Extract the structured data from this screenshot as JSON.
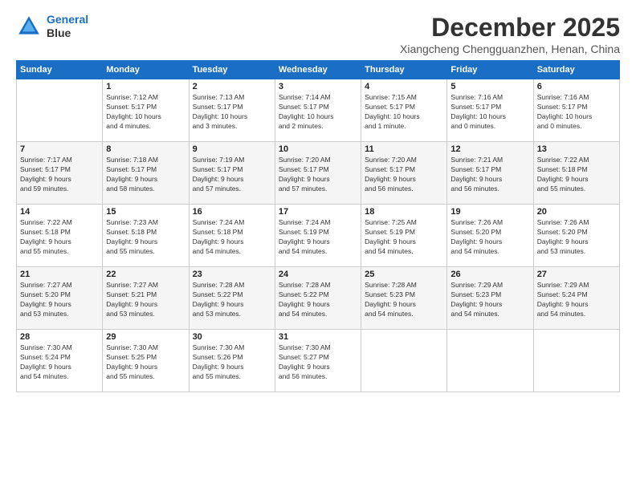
{
  "header": {
    "logo_line1": "General",
    "logo_line2": "Blue",
    "month_title": "December 2025",
    "location": "Xiangcheng Chengguanzhen, Henan, China"
  },
  "days_of_week": [
    "Sunday",
    "Monday",
    "Tuesday",
    "Wednesday",
    "Thursday",
    "Friday",
    "Saturday"
  ],
  "weeks": [
    [
      {
        "day": "",
        "info": ""
      },
      {
        "day": "1",
        "info": "Sunrise: 7:12 AM\nSunset: 5:17 PM\nDaylight: 10 hours\nand 4 minutes."
      },
      {
        "day": "2",
        "info": "Sunrise: 7:13 AM\nSunset: 5:17 PM\nDaylight: 10 hours\nand 3 minutes."
      },
      {
        "day": "3",
        "info": "Sunrise: 7:14 AM\nSunset: 5:17 PM\nDaylight: 10 hours\nand 2 minutes."
      },
      {
        "day": "4",
        "info": "Sunrise: 7:15 AM\nSunset: 5:17 PM\nDaylight: 10 hours\nand 1 minute."
      },
      {
        "day": "5",
        "info": "Sunrise: 7:16 AM\nSunset: 5:17 PM\nDaylight: 10 hours\nand 0 minutes."
      },
      {
        "day": "6",
        "info": "Sunrise: 7:16 AM\nSunset: 5:17 PM\nDaylight: 10 hours\nand 0 minutes."
      }
    ],
    [
      {
        "day": "7",
        "info": "Sunrise: 7:17 AM\nSunset: 5:17 PM\nDaylight: 9 hours\nand 59 minutes."
      },
      {
        "day": "8",
        "info": "Sunrise: 7:18 AM\nSunset: 5:17 PM\nDaylight: 9 hours\nand 58 minutes."
      },
      {
        "day": "9",
        "info": "Sunrise: 7:19 AM\nSunset: 5:17 PM\nDaylight: 9 hours\nand 57 minutes."
      },
      {
        "day": "10",
        "info": "Sunrise: 7:20 AM\nSunset: 5:17 PM\nDaylight: 9 hours\nand 57 minutes."
      },
      {
        "day": "11",
        "info": "Sunrise: 7:20 AM\nSunset: 5:17 PM\nDaylight: 9 hours\nand 56 minutes."
      },
      {
        "day": "12",
        "info": "Sunrise: 7:21 AM\nSunset: 5:17 PM\nDaylight: 9 hours\nand 56 minutes."
      },
      {
        "day": "13",
        "info": "Sunrise: 7:22 AM\nSunset: 5:18 PM\nDaylight: 9 hours\nand 55 minutes."
      }
    ],
    [
      {
        "day": "14",
        "info": "Sunrise: 7:22 AM\nSunset: 5:18 PM\nDaylight: 9 hours\nand 55 minutes."
      },
      {
        "day": "15",
        "info": "Sunrise: 7:23 AM\nSunset: 5:18 PM\nDaylight: 9 hours\nand 55 minutes."
      },
      {
        "day": "16",
        "info": "Sunrise: 7:24 AM\nSunset: 5:18 PM\nDaylight: 9 hours\nand 54 minutes."
      },
      {
        "day": "17",
        "info": "Sunrise: 7:24 AM\nSunset: 5:19 PM\nDaylight: 9 hours\nand 54 minutes."
      },
      {
        "day": "18",
        "info": "Sunrise: 7:25 AM\nSunset: 5:19 PM\nDaylight: 9 hours\nand 54 minutes."
      },
      {
        "day": "19",
        "info": "Sunrise: 7:26 AM\nSunset: 5:20 PM\nDaylight: 9 hours\nand 54 minutes."
      },
      {
        "day": "20",
        "info": "Sunrise: 7:26 AM\nSunset: 5:20 PM\nDaylight: 9 hours\nand 53 minutes."
      }
    ],
    [
      {
        "day": "21",
        "info": "Sunrise: 7:27 AM\nSunset: 5:20 PM\nDaylight: 9 hours\nand 53 minutes."
      },
      {
        "day": "22",
        "info": "Sunrise: 7:27 AM\nSunset: 5:21 PM\nDaylight: 9 hours\nand 53 minutes."
      },
      {
        "day": "23",
        "info": "Sunrise: 7:28 AM\nSunset: 5:22 PM\nDaylight: 9 hours\nand 53 minutes."
      },
      {
        "day": "24",
        "info": "Sunrise: 7:28 AM\nSunset: 5:22 PM\nDaylight: 9 hours\nand 54 minutes."
      },
      {
        "day": "25",
        "info": "Sunrise: 7:28 AM\nSunset: 5:23 PM\nDaylight: 9 hours\nand 54 minutes."
      },
      {
        "day": "26",
        "info": "Sunrise: 7:29 AM\nSunset: 5:23 PM\nDaylight: 9 hours\nand 54 minutes."
      },
      {
        "day": "27",
        "info": "Sunrise: 7:29 AM\nSunset: 5:24 PM\nDaylight: 9 hours\nand 54 minutes."
      }
    ],
    [
      {
        "day": "28",
        "info": "Sunrise: 7:30 AM\nSunset: 5:24 PM\nDaylight: 9 hours\nand 54 minutes."
      },
      {
        "day": "29",
        "info": "Sunrise: 7:30 AM\nSunset: 5:25 PM\nDaylight: 9 hours\nand 55 minutes."
      },
      {
        "day": "30",
        "info": "Sunrise: 7:30 AM\nSunset: 5:26 PM\nDaylight: 9 hours\nand 55 minutes."
      },
      {
        "day": "31",
        "info": "Sunrise: 7:30 AM\nSunset: 5:27 PM\nDaylight: 9 hours\nand 56 minutes."
      },
      {
        "day": "",
        "info": ""
      },
      {
        "day": "",
        "info": ""
      },
      {
        "day": "",
        "info": ""
      }
    ]
  ]
}
